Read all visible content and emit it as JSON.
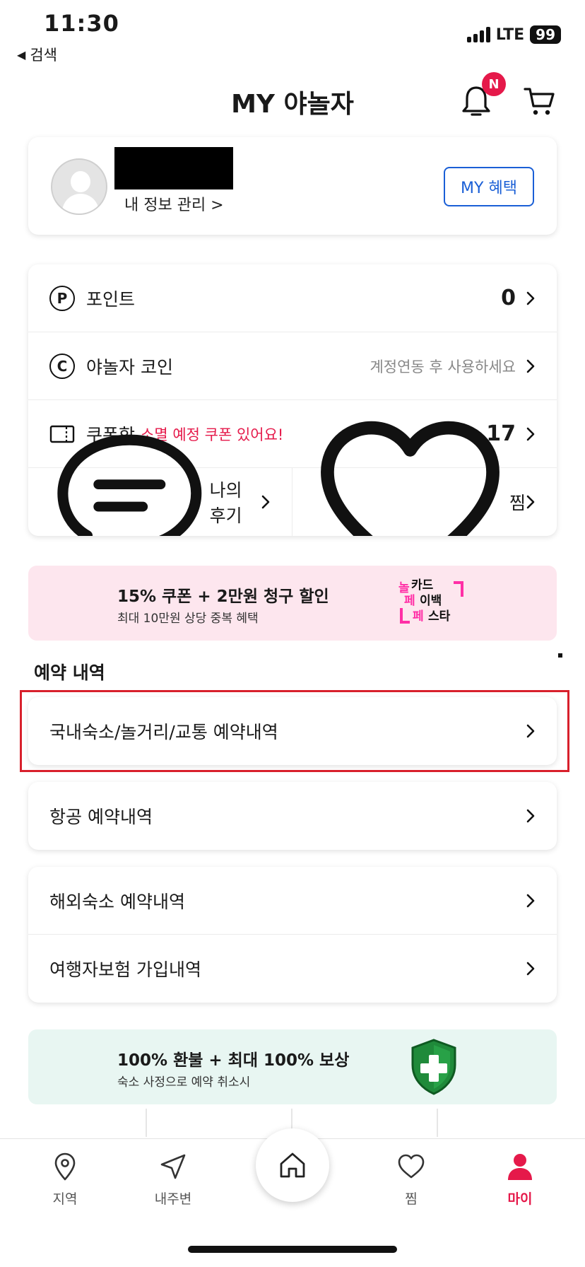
{
  "status_bar": {
    "time": "11:30",
    "back_label": "검색",
    "network": "LTE",
    "battery": "99"
  },
  "header": {
    "title": "MY 야놀자",
    "notification_badge": "N"
  },
  "profile": {
    "manage_label": "내 정보 관리 >",
    "benefit_button": "MY 혜택"
  },
  "menu": {
    "points": {
      "icon_letter": "P",
      "label": "포인트",
      "value": "0"
    },
    "coin": {
      "icon_letter": "C",
      "label": "야놀자 코인",
      "note": "계정연동 후 사용하세요"
    },
    "coupon": {
      "label": "쿠폰함",
      "alert": "소멸 예정 쿠폰 있어요!",
      "value": "17"
    },
    "review": {
      "label": "나의 후기"
    },
    "wishlist": {
      "label": "찜"
    }
  },
  "promo_banner": {
    "title": "15% 쿠폰 + 2만원 청구 할인",
    "subtitle": "최대 10만원 상당 중복 혜택",
    "logo_text": [
      "놀",
      "카드",
      "페",
      "이백",
      "페",
      "스타"
    ]
  },
  "reservations": {
    "section_title": "예약 내역",
    "domestic": "국내숙소/놀거리/교통 예약내역",
    "flight": "항공 예약내역",
    "overseas": "해외숙소 예약내역",
    "insurance": "여행자보험 가입내역"
  },
  "refund_banner": {
    "title": "100% 환불 + 최대 100% 보상",
    "subtitle": "숙소 사정으로 예약 취소시"
  },
  "tabbar": {
    "region": "지역",
    "nearby": "내주변",
    "wishlist": "찜",
    "my": "마이"
  },
  "colors": {
    "accent": "#e5194a",
    "link_blue": "#1a5fd6",
    "highlight_red": "#d8202c"
  }
}
